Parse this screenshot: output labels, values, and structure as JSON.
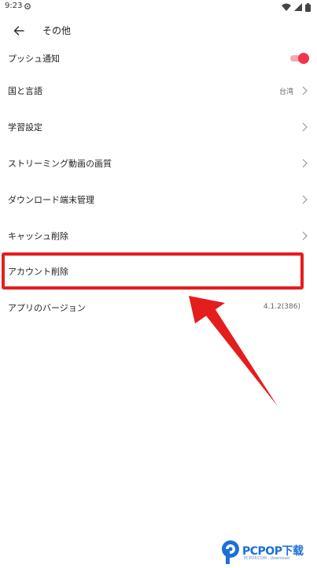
{
  "status_bar": {
    "time": "9:23",
    "icons": [
      "settings-icon",
      "wifi-icon",
      "signal-icon",
      "battery-icon"
    ]
  },
  "header": {
    "title": "その他",
    "back_icon": "arrow-left-icon"
  },
  "settings": {
    "push": {
      "label": "プッシュ通知",
      "enabled": true
    },
    "country": {
      "label": "国と言語",
      "value": "台湾"
    },
    "study": {
      "label": "学習設定"
    },
    "quality": {
      "label": "ストリーミング動画の画質"
    },
    "download": {
      "label": "ダウンロード端末管理"
    },
    "cache": {
      "label": "キャッシュ削除"
    },
    "delete_account": {
      "label": "アカウント削除"
    },
    "version": {
      "label": "アプリのバージョン",
      "value": "4.1.2(386)"
    }
  },
  "annotation": {
    "color": "#e51d1d"
  },
  "watermark": {
    "text": "PCPOP下载",
    "subtext": "PCPOP.COM · download"
  },
  "colors": {
    "accent": "#f2334f",
    "text": "#222222",
    "secondary": "#666666"
  }
}
